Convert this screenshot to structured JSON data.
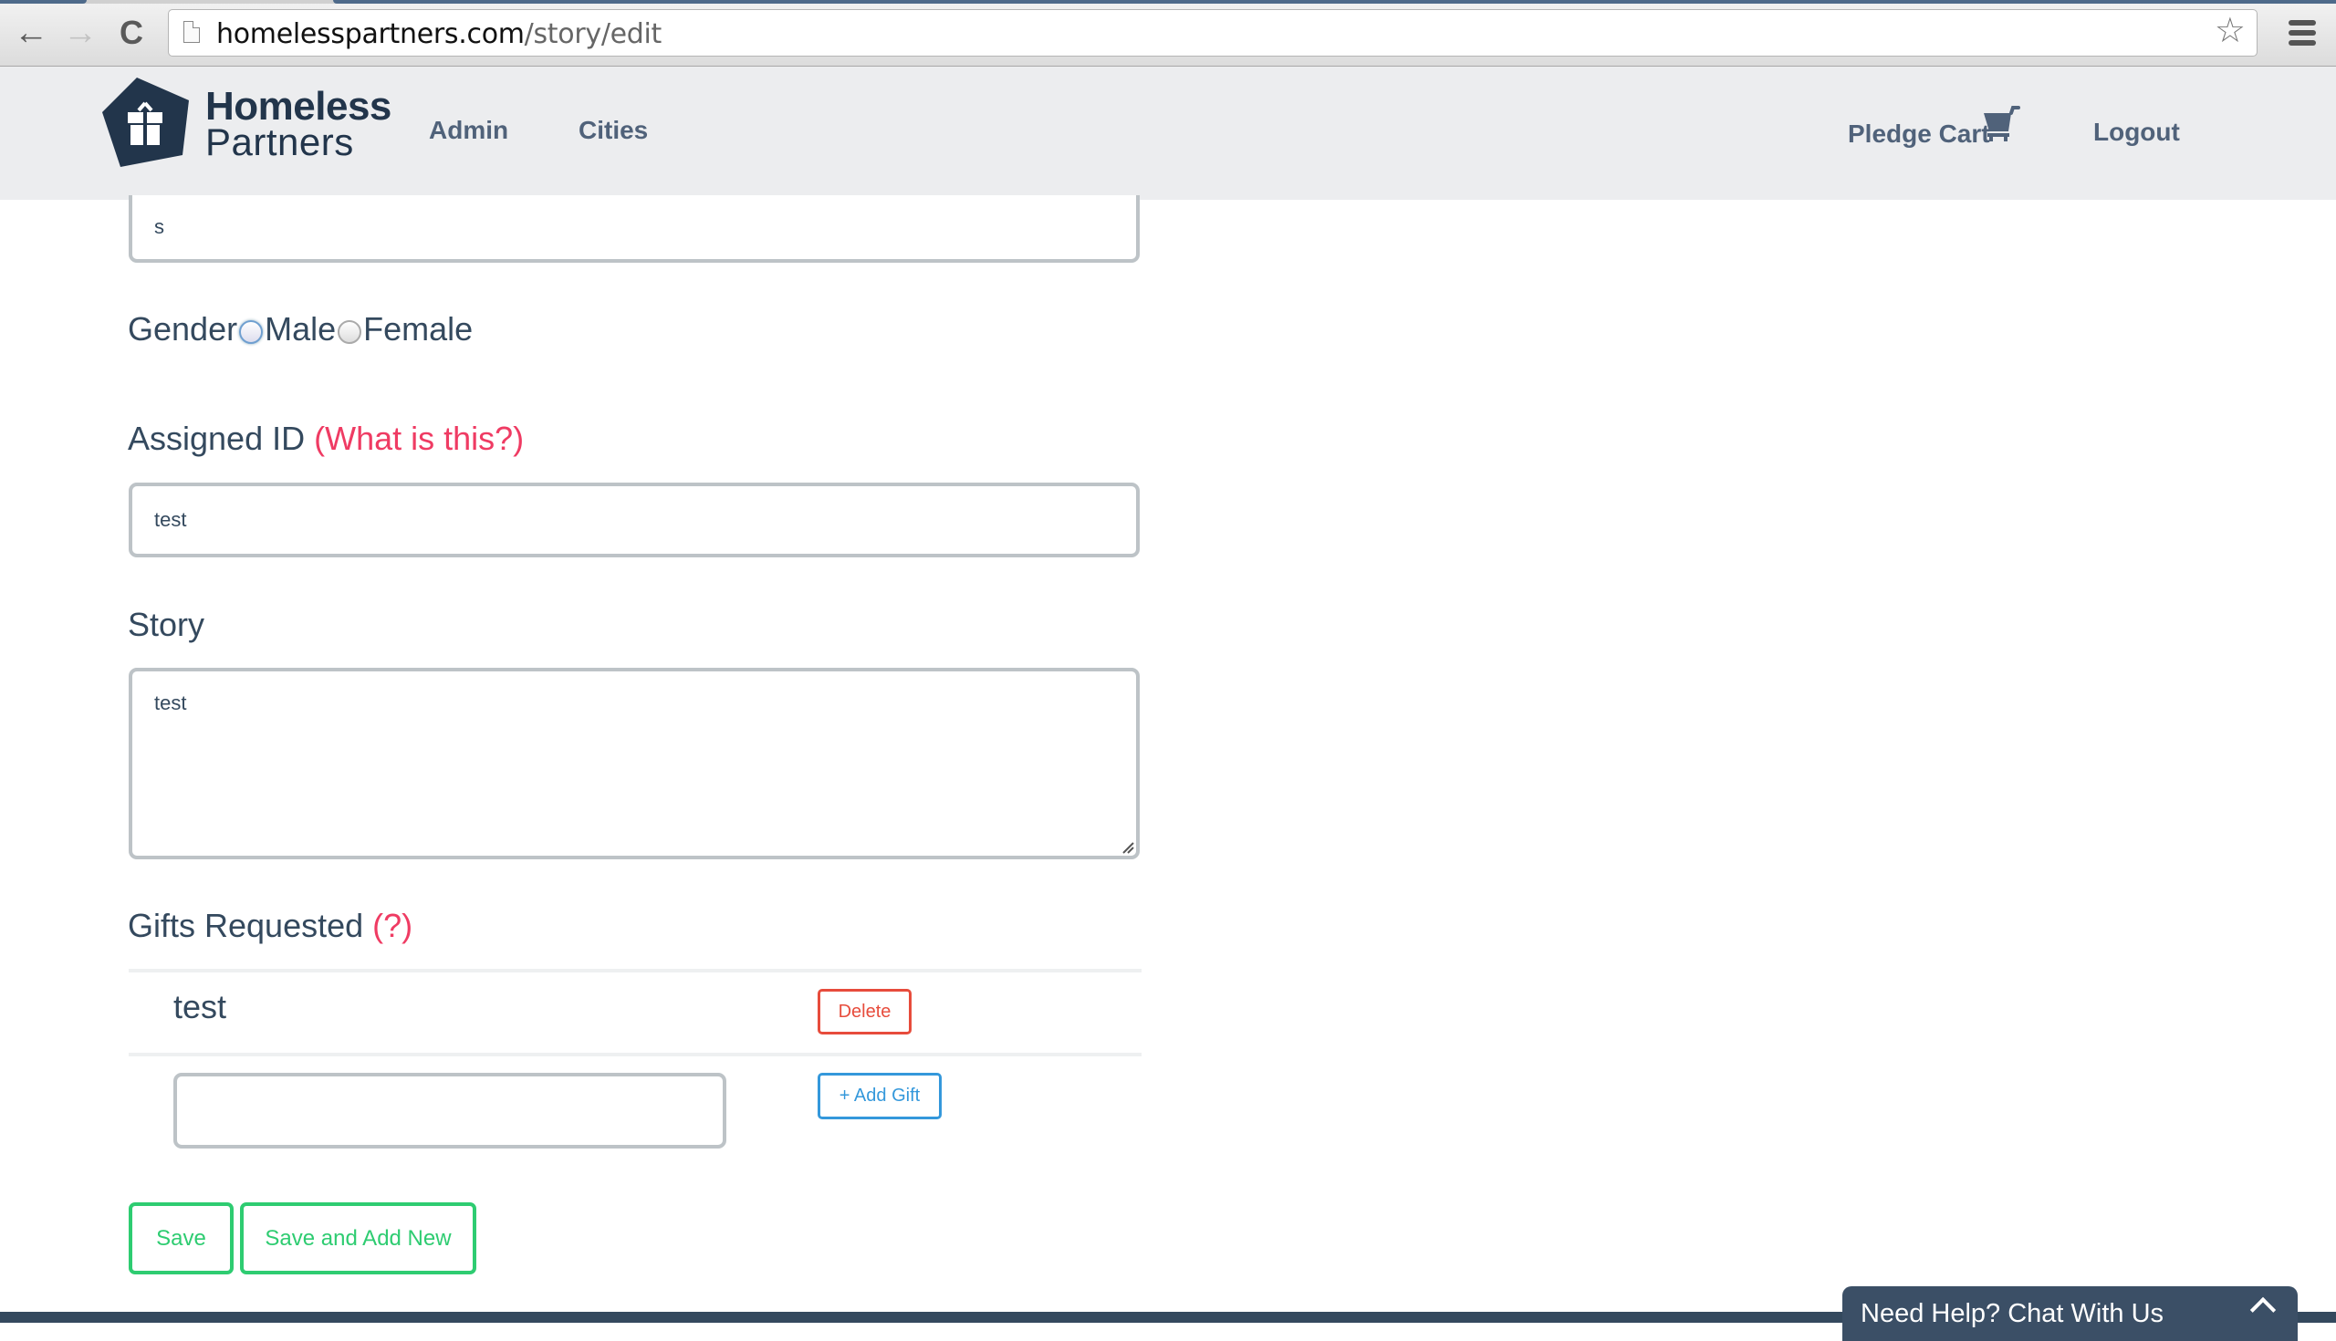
{
  "browser": {
    "url_domain": "homelesspartners.com",
    "url_path": "/story/edit",
    "back_icon": "←",
    "forward_icon": "→",
    "reload_icon": "C",
    "star_icon": "☆"
  },
  "nav": {
    "brand_line1": "Homeless",
    "brand_line2": "Partners",
    "links": [
      {
        "label": "Admin"
      },
      {
        "label": "Cities"
      }
    ],
    "pledge_cart": "Pledge Cart",
    "logout": "Logout"
  },
  "form": {
    "top_field_value": "s",
    "gender": {
      "label": "Gender",
      "options": [
        "Male",
        "Female"
      ],
      "selected": null
    },
    "assigned_id": {
      "label": "Assigned ID",
      "help": "(What is this?)",
      "value": "test"
    },
    "story": {
      "label": "Story",
      "value": "test"
    },
    "gifts": {
      "label": "Gifts Requested",
      "help": "(?)",
      "items": [
        {
          "name": "test",
          "delete_label": "Delete"
        }
      ],
      "new_gift_value": "",
      "add_label": "+ Add Gift"
    },
    "save_label": "Save",
    "save_new_label": "Save and Add New"
  },
  "chat": {
    "label": "Need Help? Chat With Us"
  },
  "colors": {
    "primary_text": "#34495e",
    "help_link": "#ef3b63",
    "danger": "#e74c3c",
    "info": "#3498db",
    "success": "#2ecc71",
    "navbar_bg": "#ecedef",
    "footer": "#34495e"
  }
}
